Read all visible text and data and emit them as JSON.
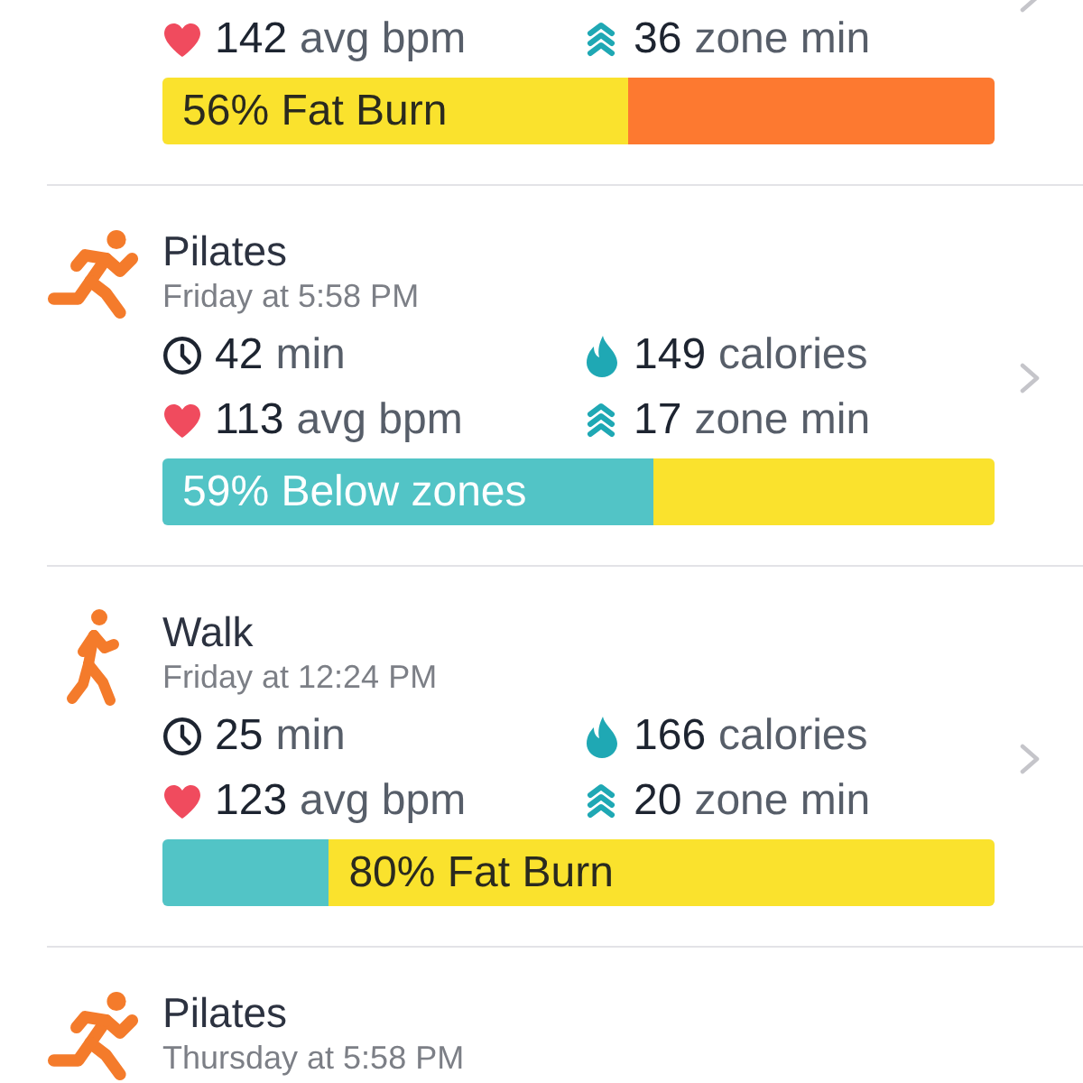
{
  "activities": [
    {
      "stats": [
        {
          "kind": "heart_rate",
          "value": "142",
          "unit": "avg bpm"
        },
        {
          "kind": "zone_minutes",
          "value": "36",
          "unit": "zone min"
        }
      ],
      "bar": {
        "segments": [
          {
            "kind": "fat_burn",
            "level": 0.56,
            "label": "56% Fat Burn"
          },
          {
            "kind": "cardio",
            "level": 0.44
          }
        ]
      }
    },
    {
      "kind": "running",
      "title": "Pilates",
      "date": "Friday at 5:58 PM",
      "stats": [
        {
          "kind": "duration",
          "value": "42",
          "unit": "min"
        },
        {
          "kind": "calories",
          "value": "149",
          "unit": "calories"
        },
        {
          "kind": "heart_rate",
          "value": "113",
          "unit": "avg bpm"
        },
        {
          "kind": "zone_minutes",
          "value": "17",
          "unit": "zone min"
        }
      ],
      "bar": {
        "segments": [
          {
            "kind": "below",
            "level": 0.59,
            "label": "59% Below zones"
          },
          {
            "kind": "fat_burn",
            "level": 0.41
          }
        ]
      }
    },
    {
      "kind": "walking",
      "title": "Walk",
      "date": "Friday at 12:24 PM",
      "stats": [
        {
          "kind": "duration",
          "value": "25",
          "unit": "min"
        },
        {
          "kind": "calories",
          "value": "166",
          "unit": "calories"
        },
        {
          "kind": "heart_rate",
          "value": "123",
          "unit": "avg bpm"
        },
        {
          "kind": "zone_minutes",
          "value": "20",
          "unit": "zone min"
        }
      ],
      "bar": {
        "segments": [
          {
            "kind": "below",
            "level": 0.2
          },
          {
            "kind": "fat_burn",
            "level": 0.8,
            "label": "80% Fat Burn"
          }
        ]
      }
    },
    {
      "kind": "running",
      "title": "Pilates",
      "date": "Thursday at 5:58 PM"
    }
  ]
}
